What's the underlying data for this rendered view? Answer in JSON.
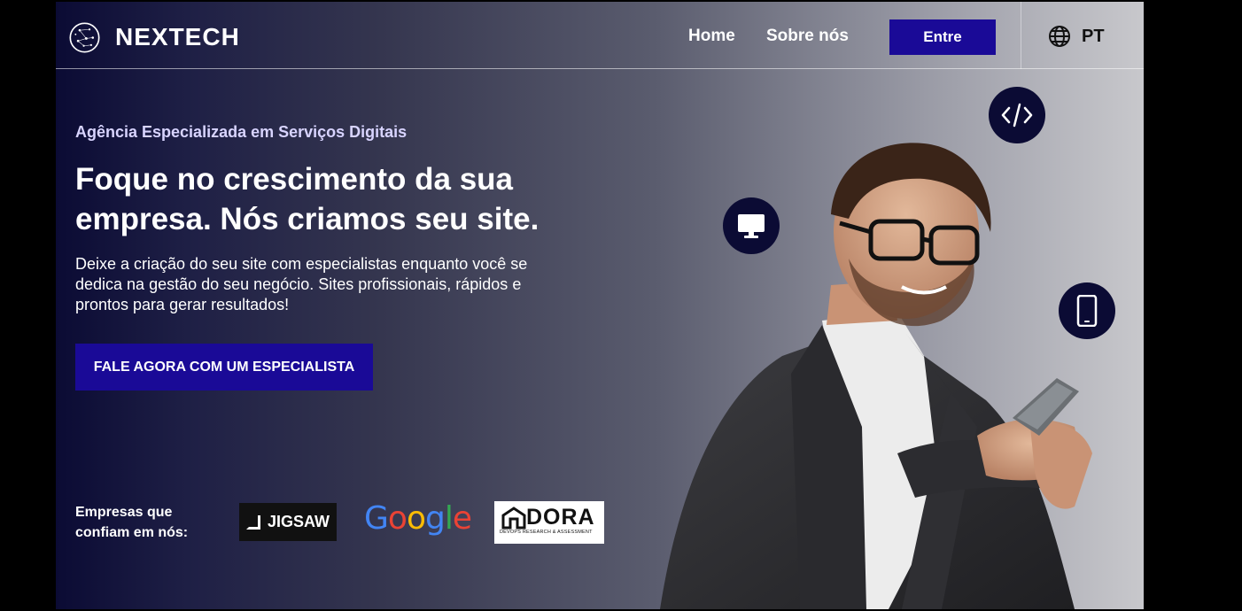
{
  "header": {
    "brand": "NEXTECH",
    "nav": {
      "home": "Home",
      "about": "Sobre nós"
    },
    "login_label": "Entre",
    "language": "PT"
  },
  "hero": {
    "eyebrow": "Agência Especializada em Serviços Digitais",
    "headline": "Foque no crescimento da sua empresa. Nós criamos seu site.",
    "subtext": "Deixe a criação do seu site com especialistas enquanto você se dedica na gestão do seu negócio. Sites profissionais, rápidos e prontos para gerar resultados!",
    "cta_label": "FALE AGORA COM UM ESPECIALISTA"
  },
  "partners": {
    "label": "Empresas que confiam em nós:",
    "logos": [
      {
        "name": "JIGSAW"
      },
      {
        "name": "Google"
      },
      {
        "name": "DORA",
        "subtitle": "DEVOPS RESEARCH & ASSESSMENT"
      }
    ]
  },
  "colors": {
    "primary_button": "#1a0a97",
    "bubble_bg": "#0b0b34",
    "eyebrow_text": "#d8d4ff"
  },
  "icons": [
    "constellation-logo-icon",
    "globe-icon",
    "code-icon",
    "desktop-icon",
    "mobile-icon"
  ]
}
